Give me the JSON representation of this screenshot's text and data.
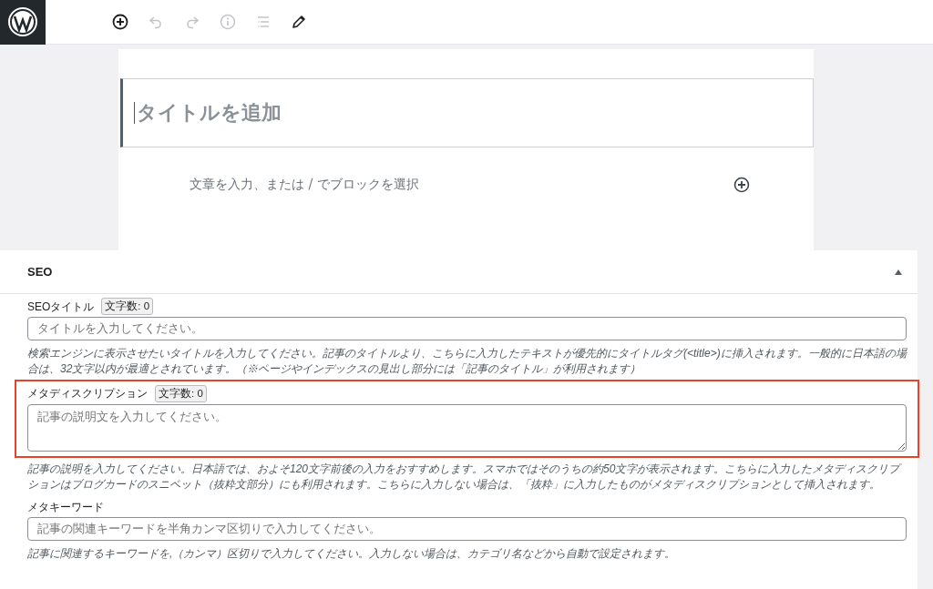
{
  "toolbar": {
    "items": [
      {
        "kind": "add",
        "disabled": false
      },
      {
        "kind": "undo",
        "disabled": true
      },
      {
        "kind": "redo",
        "disabled": true
      },
      {
        "kind": "info",
        "disabled": true
      },
      {
        "kind": "outline",
        "disabled": true
      },
      {
        "kind": "edit",
        "disabled": false
      }
    ]
  },
  "editor": {
    "title_placeholder": "タイトルを追加",
    "paragraph_placeholder": "文章を入力、または / でブロックを選択"
  },
  "seo_panel": {
    "title": "SEO",
    "expanded": true,
    "fields": [
      {
        "kind": "input",
        "label": "SEOタイトル",
        "counter": "文字数: 0",
        "placeholder": "タイトルを入力してください。",
        "highlighted": false,
        "help": "検索エンジンに表示させたいタイトルを入力してください。記事のタイトルより、こちらに入力したテキストが優先的にタイトルタグ(<title>)に挿入されます。一般的に日本語の場合は、32文字以内が最適とされています。（※ページやインデックスの見出し部分には「記事のタイトル」が利用されます）"
      },
      {
        "kind": "textarea",
        "label": "メタディスクリプション",
        "counter": "文字数: 0",
        "placeholder": "記事の説明文を入力してください。",
        "highlighted": true,
        "help": "記事の説明を入力してください。日本語では、およそ120文字前後の入力をおすすめします。スマホではそのうちの約50文字が表示されます。こちらに入力したメタディスクリプションはブログカードのスニペット（抜粋文部分）にも利用されます。こちらに入力しない場合は、「抜粋」に入力したものがメタディスクリプションとして挿入されます。"
      },
      {
        "kind": "input",
        "label": "メタキーワード",
        "placeholder": "記事の関連キーワードを半角カンマ区切りで入力してください。",
        "highlighted": false,
        "help": "記事に関連するキーワードを,（カンマ）区切りで入力してください。入力しない場合は、カテゴリ名などから自動で設定されます。"
      }
    ]
  }
}
